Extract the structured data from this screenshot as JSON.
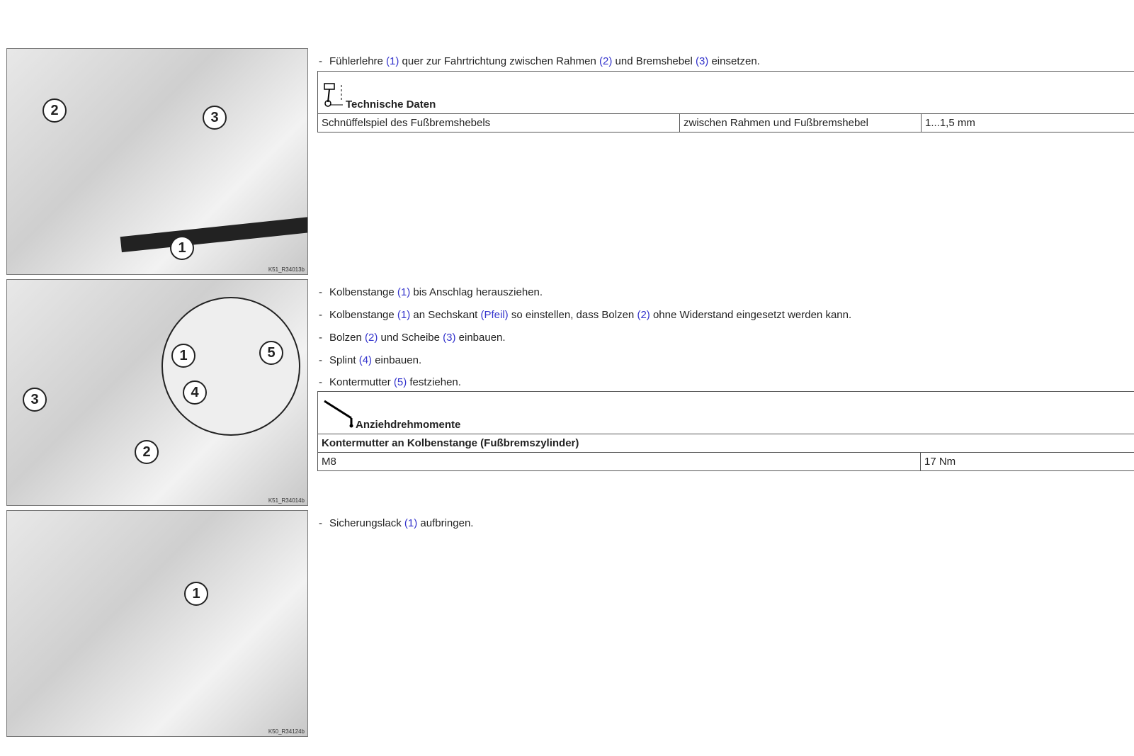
{
  "figures": [
    {
      "code": "K51_R34013b",
      "callouts": [
        "2",
        "3",
        "1"
      ]
    },
    {
      "code": "K51_R34014b",
      "callouts": [
        "1",
        "5",
        "4",
        "3",
        "2"
      ]
    },
    {
      "code": "K50_R34124b",
      "callouts": [
        "1"
      ]
    }
  ],
  "section1": {
    "step": {
      "parts": [
        "Fühlerlehre ",
        "(1)",
        " quer zur Fahrtrichtung zwischen Rahmen ",
        "(2)",
        " und Bremshebel ",
        "(3)",
        " einsetzen."
      ]
    },
    "table": {
      "icon": "piston-gauge-icon",
      "title": "Technische Daten",
      "row": [
        "Schnüffelspiel des Fußbremshebels",
        "zwischen Rahmen und Fußbremshebel",
        "1...1,5 mm"
      ]
    }
  },
  "section2": {
    "steps": [
      [
        "Kolbenstange ",
        "(1)",
        " bis Anschlag herausziehen."
      ],
      [
        "Kolbenstange ",
        "(1)",
        " an Sechskant ",
        "(Pfeil)",
        " so einstellen, dass Bolzen ",
        "(2)",
        " ohne Widerstand eingesetzt werden kann."
      ],
      [
        "Bolzen ",
        "(2)",
        " und Scheibe ",
        "(3)",
        " einbauen."
      ],
      [
        "Splint ",
        "(4)",
        " einbauen."
      ],
      [
        "Kontermutter ",
        "(5)",
        " festziehen."
      ]
    ],
    "table": {
      "icon": "torque-wrench-icon",
      "title": "Anziehdrehmomente",
      "subtitle": "Kontermutter an Kolbenstange (Fußbremszylinder)",
      "row": [
        "M8",
        "17 Nm"
      ]
    }
  },
  "section3": {
    "step": [
      "Sicherungslack ",
      "(1)",
      " aufbringen."
    ]
  },
  "colors": {
    "reference": "#3333cc"
  }
}
